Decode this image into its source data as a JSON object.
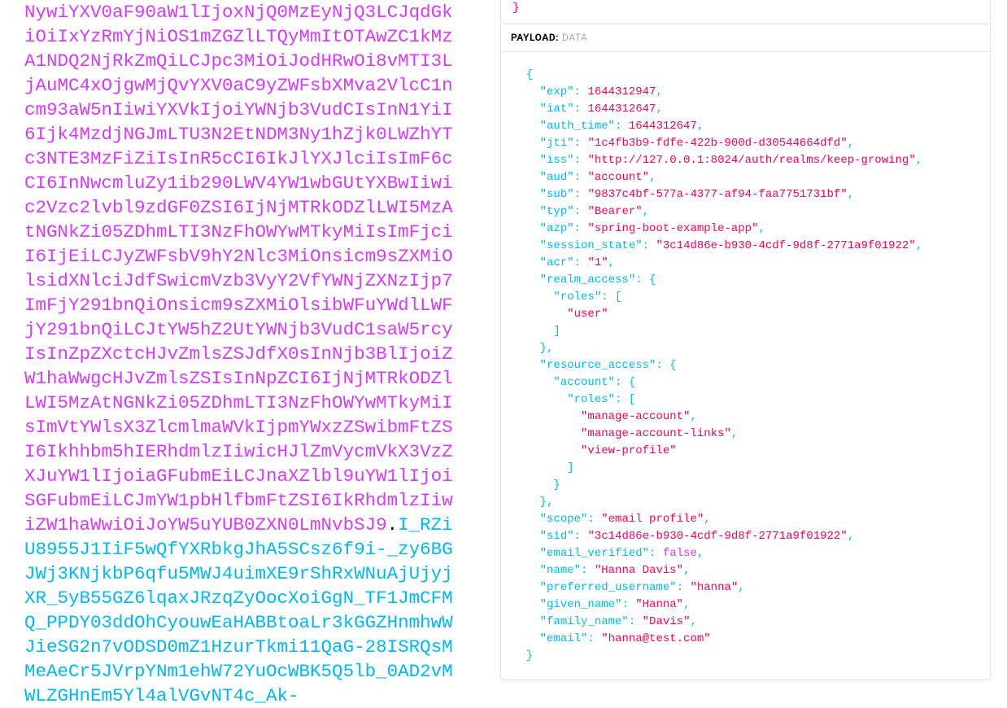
{
  "left": {
    "segment_red": "NywiYXV0aF90aW1lIjoxNjQ0MzEyNjQ3LCJqdGkiOiIxYzRmYjNiOS1mZGZlLTQyMmItOTAwZC1kMzA1NDQ2NjRkZmQiLCJpc3MiOiJodHRwOi8vMTI3LjAuMC4xOjgwMjQvYXV0aC9yZWFsbXMva2VlcC1ncm93aW5nIiwiYXVkIjoiYWNjb3VudCIsInN1YiI6Ijk4MzdjNGJmLTU3N2EtNDM3Ny1hZjk0LWZhYTc3NTE3MzFiZiIsInR5cCI6IkJlYXJlciIsImF6cCI6InNwcmluZy1ib290LWV4YW1wbGUtYXBwIiwic2Vzc2lvbl9zdGF0ZSI6IjNjMTRkODZlLWI5MzAtNGNkZi05ZDhmLTI3NzFhOWYwMTkyMiIsImFjciI6IjEiLCJyZWFsbV9hY2Nlc3MiOnsicm9sZXMiOlsidXNlciJdfSwicmVzb3VyY2VfYWNjZXNzIjp7ImFjY291bnQiOnsicm9sZXMiOlsibWFuYWdlLWFjY291bnQiLCJtYW5hZ2UtYWNjb3VudC1saW5rcyIsInZpZXctcHJvZmlsZSJdfX0sInNjb3BlIjoiZW1haWwgcHJvZmlsZSIsInNpZCI6IjNjMTRkODZlLWI5MzAtNGNkZi05ZDhmLTI3NzFhOWYwMTkyMiIsImVtYWlsX3ZlcmlmaWVkIjpmYWxzZSwibmFtZSI6Ikhhbm5hIERhdmlzIiwicHJlZmVycmVkX3VzZXJuYW1lIjoiaGFubmEiLCJnaXZlbl9uYW1lIjoiSGFubmEiLCJmYW1pbHlfbmFtZSI6IkRhdmlzIiwiZW1haWwiOiJoYW5uYUB0ZXN0LmNvbSJ9",
    "dot": ".",
    "segment_cyan": "I_RZiU8955J1IiF5wQfYXRbkgJhA5SCsz6f9i-_zy6BGJWj3KNjkbP6qfu5MWJ4uimXE9rShRxWNuAjUjyjXR_5yB55GZ6lqaxJRzqZyOocXoiGgN_TF1JmCFMQ_PPDY03ddOhCyouwEaHABBtoaLr3kGGZHnmhwWJieSG2n7vODSD0mZ1HzurTkmi11QaG-28ISRQsMMeAeCr5JVrpYNm1ehW72YuOcWBK5Q5lb_0AD2vMWLZGHnEm5Yl4alVGvNT4c_Ak-"
  },
  "right": {
    "top_brace": "}",
    "header_label": "PAYLOAD:",
    "header_sub": "DATA",
    "payload": [
      {
        "t": "brace",
        "indent": 1,
        "text": "{"
      },
      {
        "t": "kv",
        "indent": 2,
        "key": "exp",
        "val": "1644312947",
        "kind": "num",
        "comma": true
      },
      {
        "t": "kv",
        "indent": 2,
        "key": "iat",
        "val": "1644312647",
        "kind": "num",
        "comma": true
      },
      {
        "t": "kv",
        "indent": 2,
        "key": "auth_time",
        "val": "1644312647",
        "kind": "num",
        "comma": true
      },
      {
        "t": "kv",
        "indent": 2,
        "key": "jti",
        "val": "1c4fb3b9-fdfe-422b-900d-d30544664dfd",
        "kind": "str",
        "comma": true
      },
      {
        "t": "kv",
        "indent": 2,
        "key": "iss",
        "val": "http://127.0.0.1:8024/auth/realms/keep-growing",
        "kind": "str",
        "comma": true
      },
      {
        "t": "kv",
        "indent": 2,
        "key": "aud",
        "val": "account",
        "kind": "str",
        "comma": true
      },
      {
        "t": "kv",
        "indent": 2,
        "key": "sub",
        "val": "9837c4bf-577a-4377-af94-faa7751731bf",
        "kind": "str",
        "comma": true
      },
      {
        "t": "kv",
        "indent": 2,
        "key": "typ",
        "val": "Bearer",
        "kind": "str",
        "comma": true
      },
      {
        "t": "kv",
        "indent": 2,
        "key": "azp",
        "val": "spring-boot-example-app",
        "kind": "str",
        "comma": true
      },
      {
        "t": "kv",
        "indent": 2,
        "key": "session_state",
        "val": "3c14d86e-b930-4cdf-9d8f-2771a9f01922",
        "kind": "str",
        "comma": true
      },
      {
        "t": "kv",
        "indent": 2,
        "key": "acr",
        "val": "1",
        "kind": "str",
        "comma": true
      },
      {
        "t": "kobj",
        "indent": 2,
        "key": "realm_access"
      },
      {
        "t": "karr",
        "indent": 3,
        "key": "roles"
      },
      {
        "t": "arritem",
        "indent": 4,
        "val": "user",
        "comma": false
      },
      {
        "t": "arrclose",
        "indent": 3,
        "comma": false
      },
      {
        "t": "objclose",
        "indent": 2,
        "comma": true
      },
      {
        "t": "kobj",
        "indent": 2,
        "key": "resource_access"
      },
      {
        "t": "kobj",
        "indent": 3,
        "key": "account"
      },
      {
        "t": "karr",
        "indent": 4,
        "key": "roles"
      },
      {
        "t": "arritem",
        "indent": 5,
        "val": "manage-account",
        "comma": true
      },
      {
        "t": "arritem",
        "indent": 5,
        "val": "manage-account-links",
        "comma": true
      },
      {
        "t": "arritem",
        "indent": 5,
        "val": "view-profile",
        "comma": false
      },
      {
        "t": "arrclose",
        "indent": 4,
        "comma": false
      },
      {
        "t": "objclose",
        "indent": 3,
        "comma": false
      },
      {
        "t": "objclose",
        "indent": 2,
        "comma": true
      },
      {
        "t": "kv",
        "indent": 2,
        "key": "scope",
        "val": "email profile",
        "kind": "str",
        "comma": true
      },
      {
        "t": "kv",
        "indent": 2,
        "key": "sid",
        "val": "3c14d86e-b930-4cdf-9d8f-2771a9f01922",
        "kind": "str",
        "comma": true
      },
      {
        "t": "kv",
        "indent": 2,
        "key": "email_verified",
        "val": "false",
        "kind": "bool",
        "comma": true
      },
      {
        "t": "kv",
        "indent": 2,
        "key": "name",
        "val": "Hanna Davis",
        "kind": "str",
        "comma": true
      },
      {
        "t": "kv",
        "indent": 2,
        "key": "preferred_username",
        "val": "hanna",
        "kind": "str",
        "comma": true
      },
      {
        "t": "kv",
        "indent": 2,
        "key": "given_name",
        "val": "Hanna",
        "kind": "str",
        "comma": true
      },
      {
        "t": "kv",
        "indent": 2,
        "key": "family_name",
        "val": "Davis",
        "kind": "str",
        "comma": true
      },
      {
        "t": "kv",
        "indent": 2,
        "key": "email",
        "val": "hanna@test.com",
        "kind": "str",
        "comma": false
      },
      {
        "t": "braceclose",
        "indent": 1,
        "text": "}"
      }
    ]
  }
}
